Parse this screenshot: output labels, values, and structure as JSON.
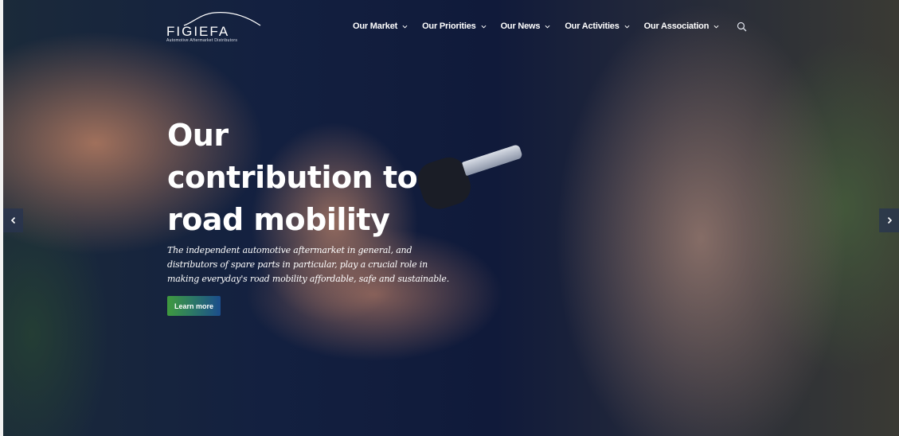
{
  "brand": {
    "name": "FIGIEFA",
    "tagline": "Automotive Aftermarket Distributors"
  },
  "nav": {
    "items": [
      {
        "label": "Our Market"
      },
      {
        "label": "Our Priorities"
      },
      {
        "label": "Our News"
      },
      {
        "label": "Our Activities"
      },
      {
        "label": "Our Association"
      }
    ],
    "search_icon": "search-icon"
  },
  "hero": {
    "headline_lines": [
      "Our",
      "contribution to",
      "road mobility"
    ],
    "lead_lines": [
      "The independent automotive aftermarket in general, and",
      "distributors of spare parts in particular, play a crucial role in",
      "making everyday's road mobility affordable, safe and sustainable."
    ],
    "cta_label": "Learn more",
    "prev_icon": "chevron-left-icon",
    "next_icon": "chevron-right-icon"
  },
  "colors": {
    "accent_green": "#3f9a3e",
    "accent_blue": "#1b4d8c",
    "text": "#ffffff"
  }
}
